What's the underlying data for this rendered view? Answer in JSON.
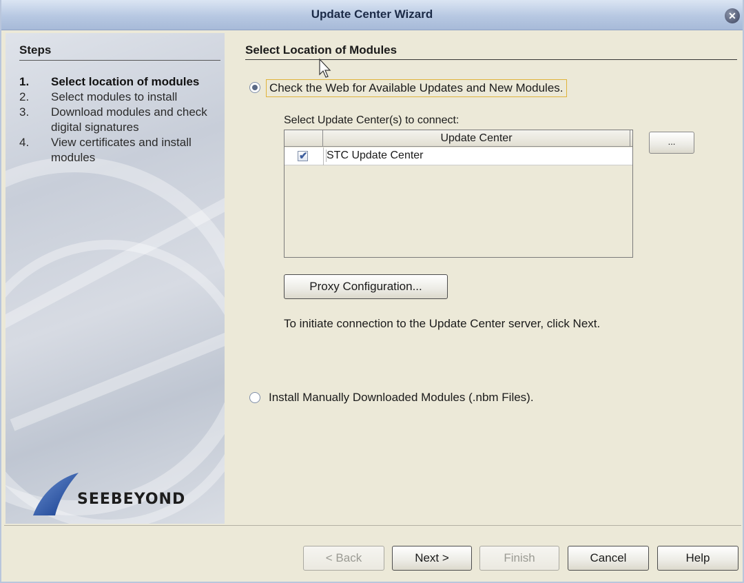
{
  "window": {
    "title": "Update Center Wizard"
  },
  "steps": {
    "heading": "Steps",
    "items": [
      {
        "num": "1.",
        "label": "Select location of modules",
        "active": true
      },
      {
        "num": "2.",
        "label": "Select modules to install",
        "active": false
      },
      {
        "num": "3.",
        "label": "Download modules and check digital signatures",
        "active": false
      },
      {
        "num": "4.",
        "label": "View certificates and install modules",
        "active": false
      }
    ],
    "logo_text": "SEEBEYOND"
  },
  "main": {
    "heading": "Select Location of Modules",
    "option_web_label": "Check the Web for Available Updates and New Modules.",
    "update_center_label": "Select Update Center(s) to connect:",
    "table": {
      "column_header": "Update Center",
      "rows": [
        {
          "checked": true,
          "name": "STC Update Center"
        }
      ]
    },
    "browse_button": "...",
    "proxy_button": "Proxy Configuration...",
    "info_text": "To initiate connection to the Update Center server, click Next.",
    "option_manual_label": "Install Manually Downloaded Modules (.nbm Files)."
  },
  "footer": {
    "back": "< Back",
    "next": "Next >",
    "finish": "Finish",
    "cancel": "Cancel",
    "help": "Help"
  },
  "colors": {
    "background": "#ece9d8",
    "titlebar": "#b7c8e2",
    "focus_outline": "#e0b33a"
  }
}
